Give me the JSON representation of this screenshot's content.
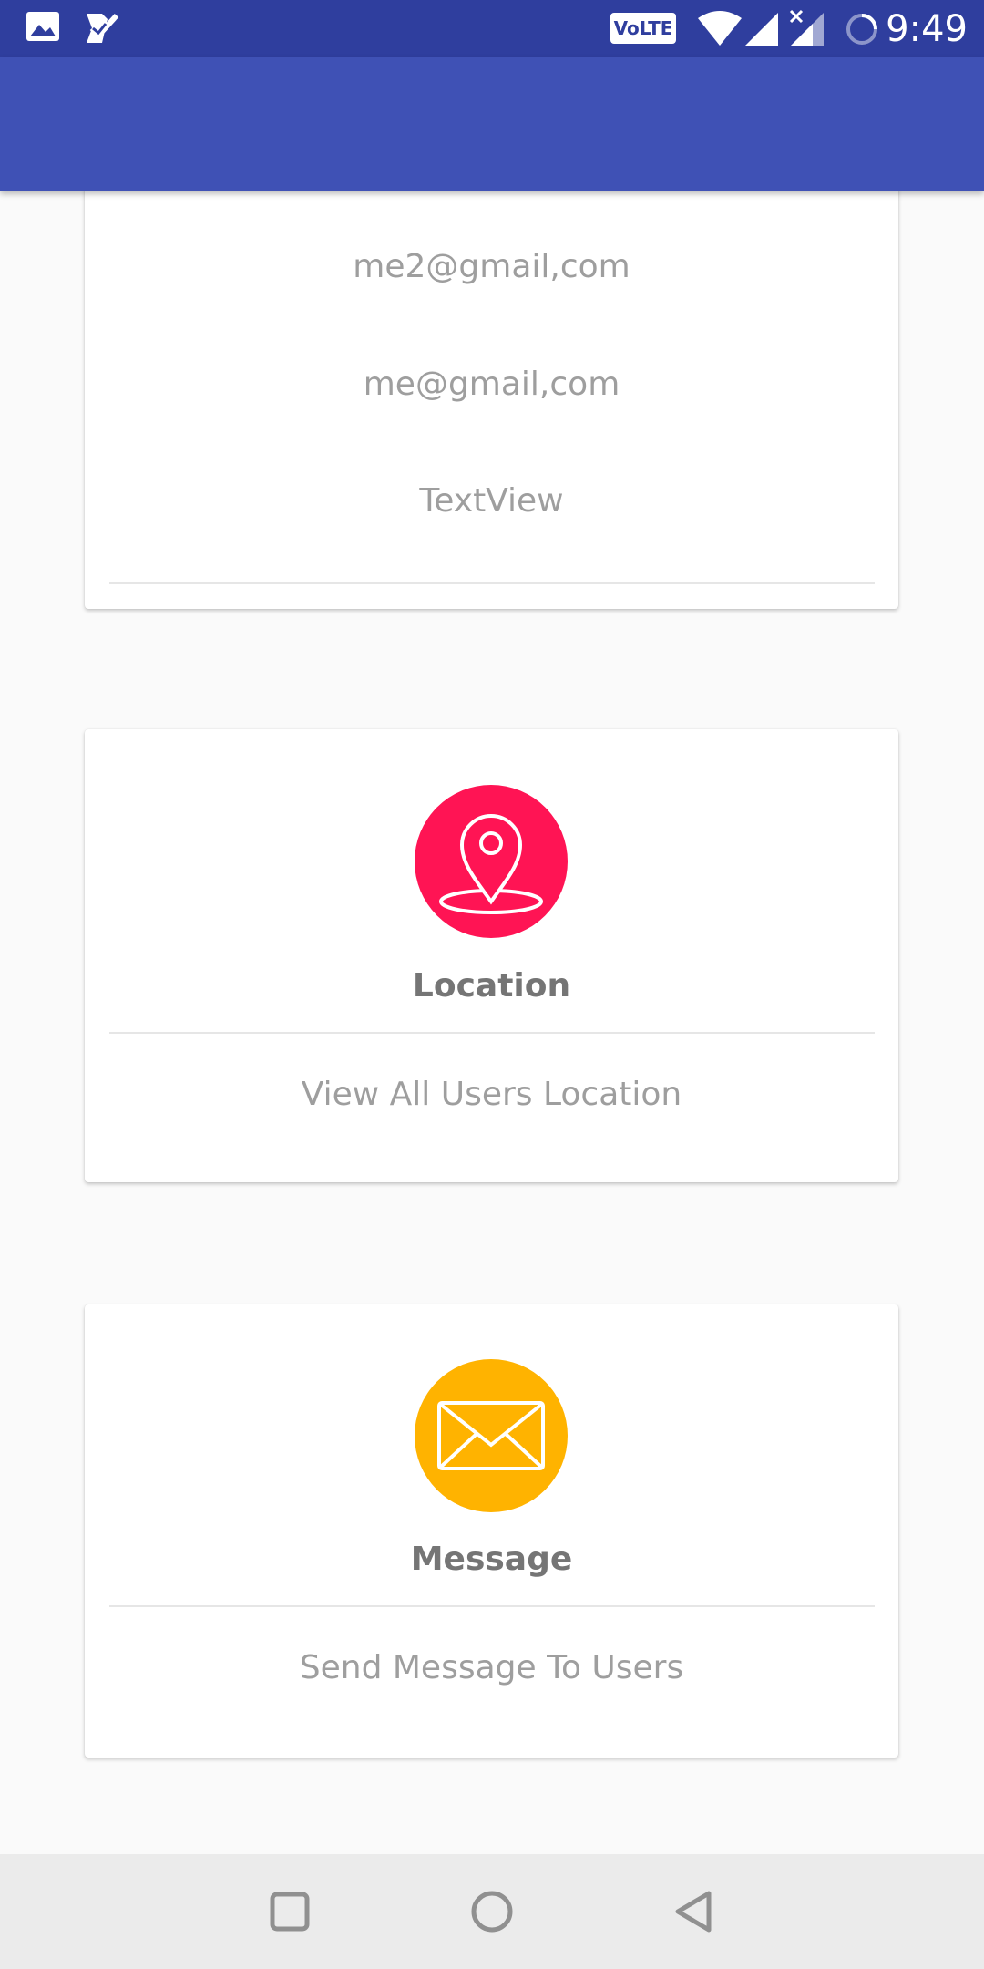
{
  "status_bar": {
    "time": "9:49",
    "network_badge": "VoLTE",
    "icons": [
      "gallery-icon",
      "task-check-icon",
      "wifi-icon",
      "signal-icon",
      "signal-no-data-icon",
      "sync-icon"
    ]
  },
  "colors": {
    "status_bar": "#2f3e9e",
    "app_bar": "#3f51b5",
    "location_accent": "#ff1454",
    "message_accent": "#ffb300"
  },
  "info_card": {
    "lines": [
      "me2@gmail,com",
      "me@gmail,com",
      "TextView"
    ]
  },
  "location_card": {
    "icon": "location-pin-icon",
    "title": "Location",
    "subtitle": "View All Users Location"
  },
  "message_card": {
    "icon": "envelope-icon",
    "title": "Message",
    "subtitle": "Send Message To Users"
  },
  "nav_bar": {
    "buttons": [
      "recents-button",
      "home-button",
      "back-button"
    ]
  }
}
